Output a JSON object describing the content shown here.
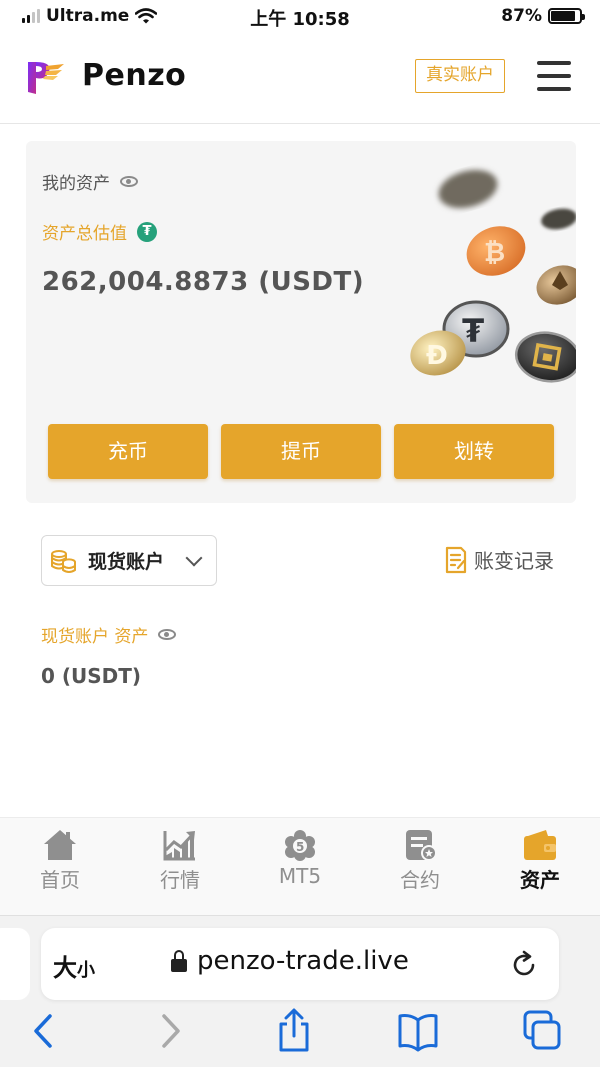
{
  "status_bar": {
    "carrier": "Ultra.me",
    "time": "上午 10:58",
    "battery": "87%",
    "battery_level": 0.87
  },
  "header": {
    "brand": "Penzo",
    "real_account_label": "真实账户"
  },
  "asset_card": {
    "my_assets_label": "我的资产",
    "estimated_label": "资产总估值",
    "usdt_symbol": "₮",
    "total_value": "262,004.8873 (USDT)",
    "actions": {
      "deposit": "充币",
      "withdraw": "提币",
      "transfer": "划转"
    }
  },
  "account": {
    "selected": "现货账户",
    "history_label": "账变记录",
    "spot_assets_label": "现货账户 资产",
    "spot_value": "0 (USDT)"
  },
  "tabs": [
    {
      "label": "首页",
      "icon": "home-icon",
      "active": false
    },
    {
      "label": "行情",
      "icon": "market-chart-icon",
      "active": false
    },
    {
      "label": "MT5",
      "icon": "mt5-icon",
      "active": false
    },
    {
      "label": "合约",
      "icon": "contract-icon",
      "active": false
    },
    {
      "label": "资产",
      "icon": "wallet-icon",
      "active": true
    }
  ],
  "browser": {
    "text_size_big": "大",
    "text_size_small": "小",
    "url": "penzo-trade.live"
  },
  "colors": {
    "accent": "#e5a52b",
    "usdt": "#26a17b",
    "text_muted": "#555555"
  }
}
